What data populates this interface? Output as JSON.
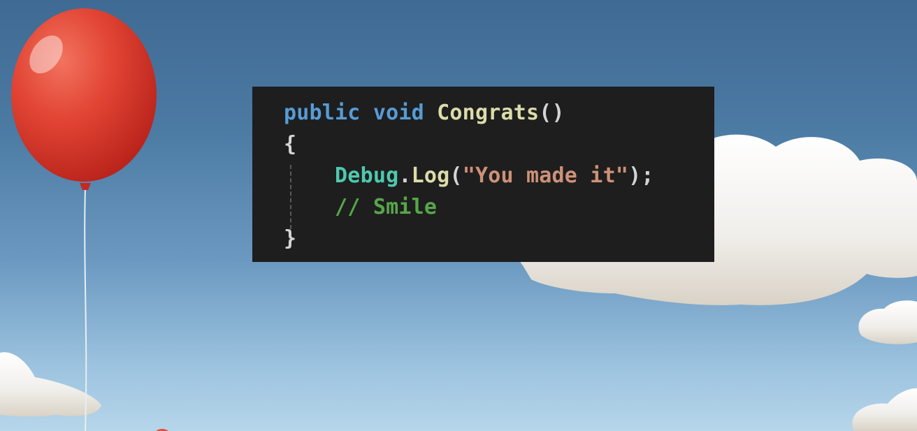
{
  "code_snippet": {
    "colors": {
      "background": "#1e1e1e",
      "keyword": "#569cd6",
      "method": "#dcdcaa",
      "class": "#4ec9b0",
      "punctuation": "#d4d4d4",
      "string": "#ce9178",
      "comment": "#57a64a"
    },
    "lines": [
      {
        "indent": "",
        "tokens": [
          {
            "text": "public",
            "kind": "keyword"
          },
          {
            "text": " ",
            "kind": "punctuation"
          },
          {
            "text": "void",
            "kind": "keyword"
          },
          {
            "text": " ",
            "kind": "punctuation"
          },
          {
            "text": "Congrats",
            "kind": "method"
          },
          {
            "text": "()",
            "kind": "punctuation"
          }
        ]
      },
      {
        "indent": "",
        "tokens": [
          {
            "text": "{",
            "kind": "punctuation"
          }
        ]
      },
      {
        "indent": "    ",
        "tokens": [
          {
            "text": "Debug",
            "kind": "class"
          },
          {
            "text": ".",
            "kind": "punctuation"
          },
          {
            "text": "Log",
            "kind": "method"
          },
          {
            "text": "(",
            "kind": "punctuation"
          },
          {
            "text": "\"You made it\"",
            "kind": "string"
          },
          {
            "text": ");",
            "kind": "punctuation"
          }
        ]
      },
      {
        "indent": "    ",
        "tokens": [
          {
            "text": "// Smile",
            "kind": "comment"
          }
        ]
      },
      {
        "indent": "",
        "tokens": [
          {
            "text": "}",
            "kind": "punctuation"
          }
        ]
      }
    ]
  },
  "scene": {
    "sky_color": "#4b7aa3",
    "balloon_color": "#d8382c",
    "cloud_color": "#f2f0ec",
    "objects": [
      "balloon",
      "clouds"
    ]
  }
}
